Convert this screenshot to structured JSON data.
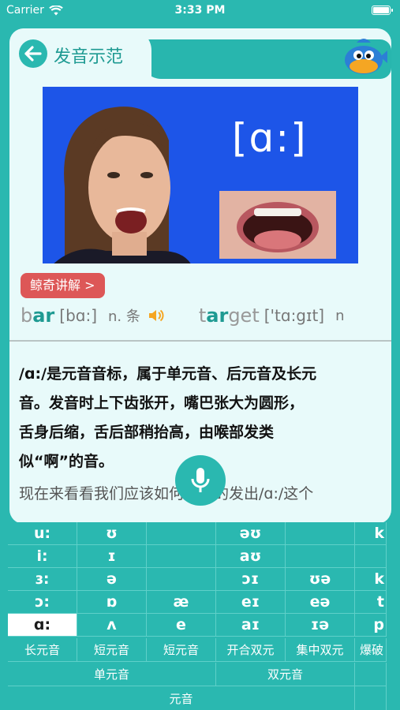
{
  "status": {
    "carrier": "Carrier",
    "time": "3:33 PM"
  },
  "header": {
    "title": "发音示范"
  },
  "video": {
    "ipa": "[ɑ:]"
  },
  "explain_button": "鲸奇讲解 >",
  "examples": [
    {
      "word_pre": "b",
      "word_hl": "ar",
      "word_post": "",
      "phonetic": "[bɑ:]",
      "pos": "n. 条"
    },
    {
      "word_pre": "t",
      "word_hl": "ar",
      "word_post": "get",
      "phonetic": "['tɑ:gɪt]",
      "pos": "n"
    }
  ],
  "description": {
    "lines": [
      "/ɑ:/是元音音标，属于单元音、后元音及长元",
      "音。发音时上下齿张开，嘴巴张大为圆形，",
      "舌身后缩，舌后部稍抬高，由喉部发类",
      "似“啊”的音。"
    ],
    "tail": "现在来看看我们应该如何正确的发出/ɑ:/这个"
  },
  "keyboard": {
    "rows": [
      [
        "u:",
        "ʊ",
        "",
        "əʊ",
        "",
        "k"
      ],
      [
        "i:",
        "ɪ",
        "",
        "aʊ",
        "",
        ""
      ],
      [
        "ɜ:",
        "ə",
        "",
        "ɔɪ",
        "ʊə",
        "k"
      ],
      [
        "ɔ:",
        "ɒ",
        "æ",
        "eɪ",
        "eə",
        "t"
      ],
      [
        "ɑ:",
        "ʌ",
        "e",
        "aɪ",
        "ɪə",
        "p"
      ]
    ],
    "selected": "ɑ:",
    "categories": [
      "长元音",
      "短元音",
      "短元音",
      "开合双元",
      "集中双元",
      "爆破"
    ],
    "groups": [
      "单元音",
      "双元音",
      ""
    ],
    "top": [
      "元音",
      ""
    ]
  },
  "colors": {
    "accent": "#2ab8b0",
    "explain": "#dd5757",
    "video_bg": "#1d55e8"
  }
}
